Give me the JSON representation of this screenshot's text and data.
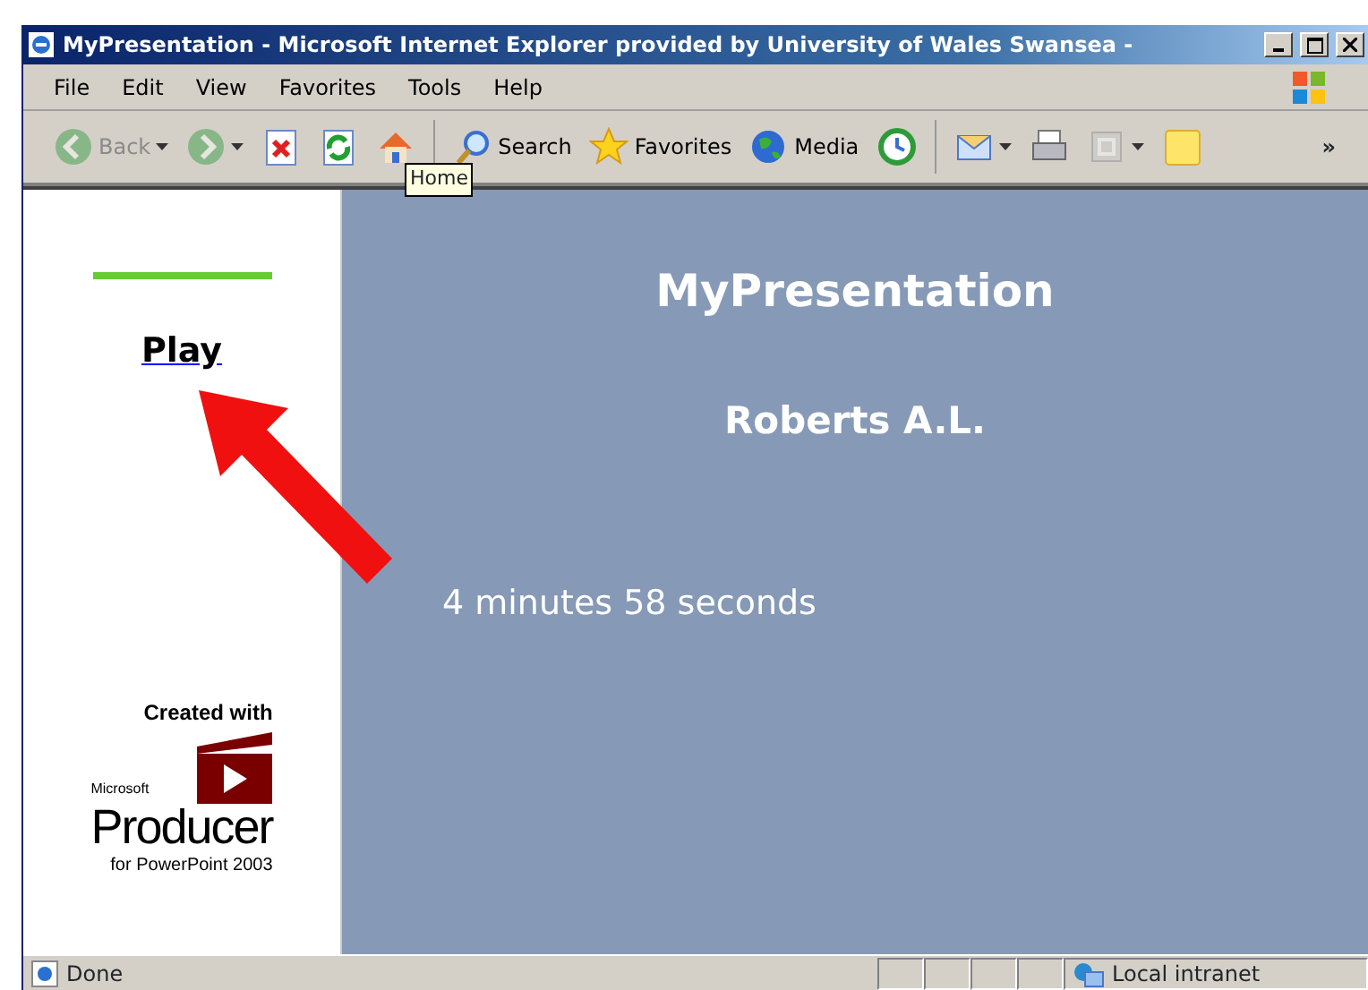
{
  "window": {
    "title": "MyPresentation - Microsoft Internet Explorer provided by University of Wales Swansea -"
  },
  "menu": [
    "File",
    "Edit",
    "View",
    "Favorites",
    "Tools",
    "Help"
  ],
  "toolbar": [
    {
      "kind": "back",
      "label": "Back",
      "disabled": true,
      "dropdown": true
    },
    {
      "kind": "forward",
      "disabled": true,
      "dropdown": true
    },
    {
      "kind": "stop",
      "disabled": false,
      "dropdown": false
    },
    {
      "kind": "refresh",
      "disabled": false,
      "dropdown": false
    },
    {
      "kind": "home",
      "disabled": false,
      "dropdown": false,
      "tooltip": "Home"
    },
    {
      "kind": "search",
      "label": "Search",
      "disabled": false,
      "dropdown": false
    },
    {
      "kind": "favorites",
      "label": "Favorites",
      "disabled": false,
      "dropdown": false
    },
    {
      "kind": "media",
      "label": "Media",
      "disabled": false,
      "dropdown": false
    },
    {
      "kind": "history",
      "disabled": false,
      "dropdown": false
    },
    {
      "kind": "mail",
      "disabled": false,
      "dropdown": true
    },
    {
      "kind": "print",
      "disabled": false,
      "dropdown": false
    },
    {
      "kind": "edit",
      "disabled": true,
      "dropdown": true
    },
    {
      "kind": "note",
      "disabled": false,
      "dropdown": false
    }
  ],
  "toolbar_overflow": "»",
  "sidebar": {
    "link": "Play",
    "logo": {
      "caption": "Created with",
      "maker": "Microsoft",
      "product": "Producer",
      "subtitle": "for PowerPoint 2003"
    }
  },
  "slide": {
    "title": "MyPresentation",
    "author": "Roberts A.L.",
    "duration": "4 minutes 58 seconds"
  },
  "status_bar": {
    "text": "Done",
    "zone": "Local intranet"
  }
}
